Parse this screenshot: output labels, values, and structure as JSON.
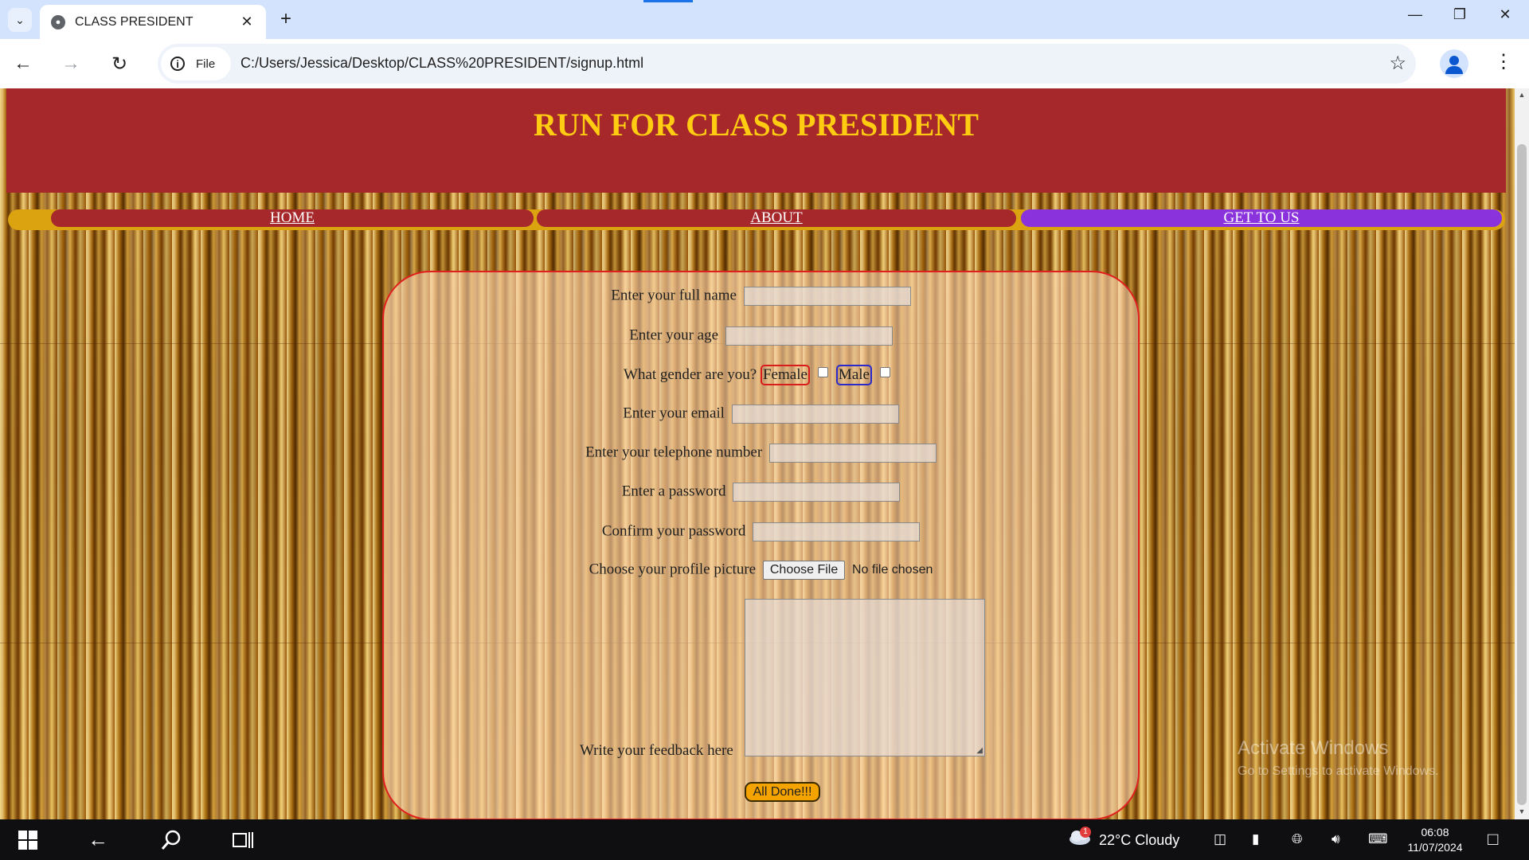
{
  "browser": {
    "tab_title": "CLASS PRESIDENT",
    "url": "C:/Users/Jessica/Desktop/CLASS%20PRESIDENT/signup.html",
    "site_info_label": "File"
  },
  "page": {
    "title": "RUN FOR CLASS PRESIDENT",
    "nav": [
      {
        "label": "HOME",
        "color": "#a6282b"
      },
      {
        "label": "ABOUT",
        "color": "#a6282b"
      },
      {
        "label": "GET TO US",
        "color": "#8a33dd"
      }
    ],
    "form": {
      "full_name_label": "Enter your full name",
      "age_label": "Enter your age",
      "gender_label": "What gender are you?",
      "female_label": "Female",
      "male_label": "Male",
      "email_label": "Enter your email",
      "phone_label": "Enter your telephone number",
      "password_label": "Enter a password",
      "confirm_label": "Confirm your password",
      "picture_label": "Choose your profile picture",
      "choose_file_label": "Choose File",
      "no_file_text": "No file chosen",
      "feedback_label": "Write your feedback here",
      "submit_label": "All Done!!!"
    }
  },
  "watermark": {
    "line1": "Activate Windows",
    "line2": "Go to Settings to activate Windows."
  },
  "taskbar": {
    "weather_badge": "1",
    "weather": "22°C  Cloudy",
    "time": "06:08",
    "date": "11/07/2024"
  },
  "colors": {
    "banner": "#a6282b",
    "title": "#ffcc11",
    "navbar": "#dba310",
    "accent_purple": "#8a33dd",
    "submit": "#f5a300"
  }
}
